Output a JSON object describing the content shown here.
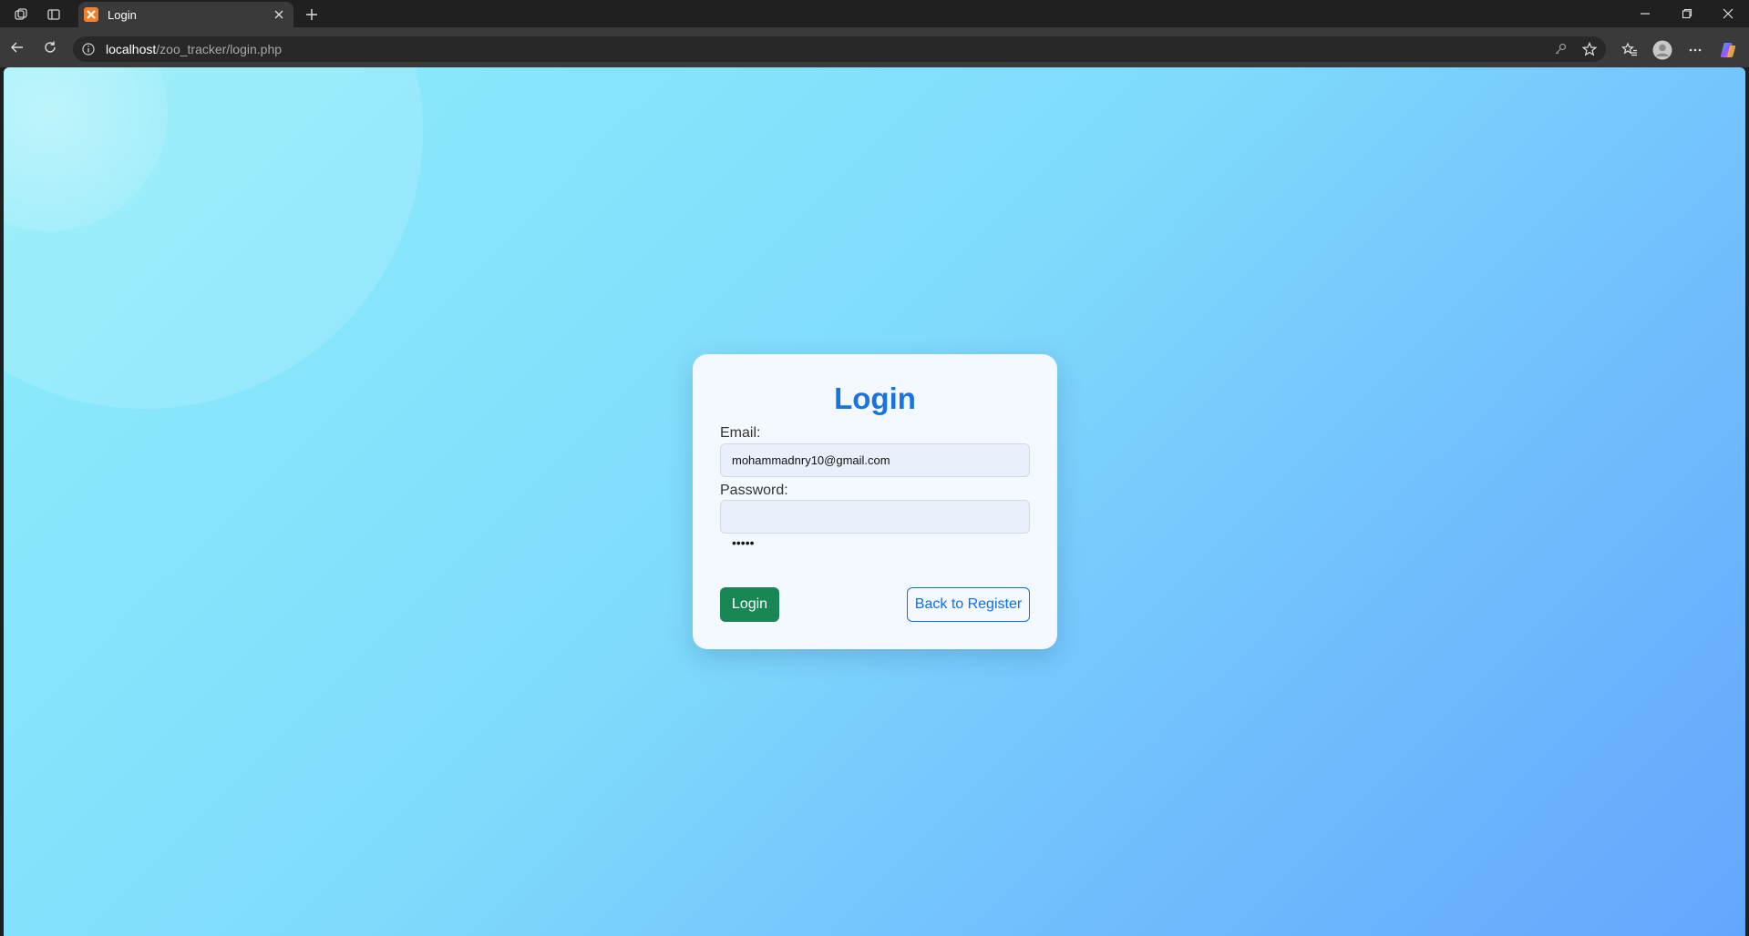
{
  "browser": {
    "tab_title": "Login",
    "url_host": "localhost",
    "url_path": "/zoo_tracker/login.php"
  },
  "icons": {
    "workspaces": "workspaces-icon",
    "tab_actions": "tab-actions-icon",
    "favicon": "xampp-favicon-icon",
    "close_tab": "close-icon",
    "new_tab": "plus-icon",
    "back": "back-arrow-icon",
    "refresh": "refresh-icon",
    "site_info": "info-icon",
    "key": "key-icon",
    "favorite": "star-icon",
    "favorites": "favorites-icon",
    "profile": "profile-icon",
    "more": "more-icon",
    "copilot": "copilot-icon"
  },
  "login": {
    "title": "Login",
    "email_label": "Email:",
    "email_value": "mohammadnry10@gmail.com",
    "password_label": "Password:",
    "password_mask": "•••••",
    "login_button": "Login",
    "register_button": "Back to Register"
  },
  "colors": {
    "title": "#1874e0",
    "login_button": "#198754",
    "register_button": "#0d6efd"
  }
}
